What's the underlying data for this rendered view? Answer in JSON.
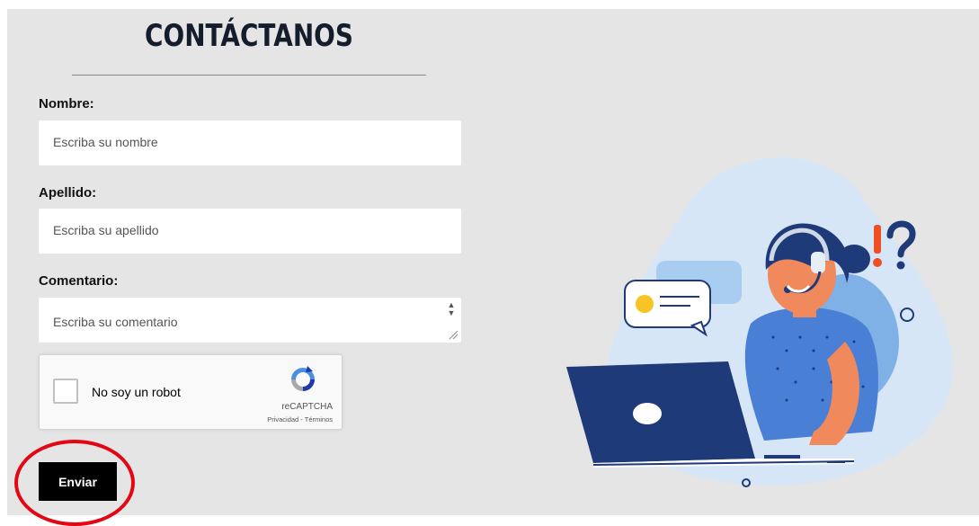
{
  "form": {
    "title": "CONTÁCTANOS",
    "fields": [
      {
        "label": "Nombre:",
        "placeholder": "Escriba su nombre"
      },
      {
        "label": "Apellido:",
        "placeholder": "Escriba su apellido"
      },
      {
        "label": "Comentario:",
        "placeholder": "Escriba su comentario"
      }
    ],
    "captcha": {
      "label": "No soy un robot",
      "brand": "reCAPTCHA",
      "links": "Privacidad - Términos"
    },
    "submit_label": "Enviar"
  },
  "colors": {
    "panel_bg": "#e5e5e5",
    "title": "#141d2b",
    "button_bg": "#000000",
    "highlight": "#e30613",
    "illustration_navy": "#1e3a78",
    "illustration_blue": "#4a7fd6",
    "illustration_accent": "#f04e23"
  },
  "icons": [
    "recaptcha-logo-icon",
    "support-agent-illustration",
    "chat-bubble-icon",
    "exclamation-question-icon"
  ]
}
